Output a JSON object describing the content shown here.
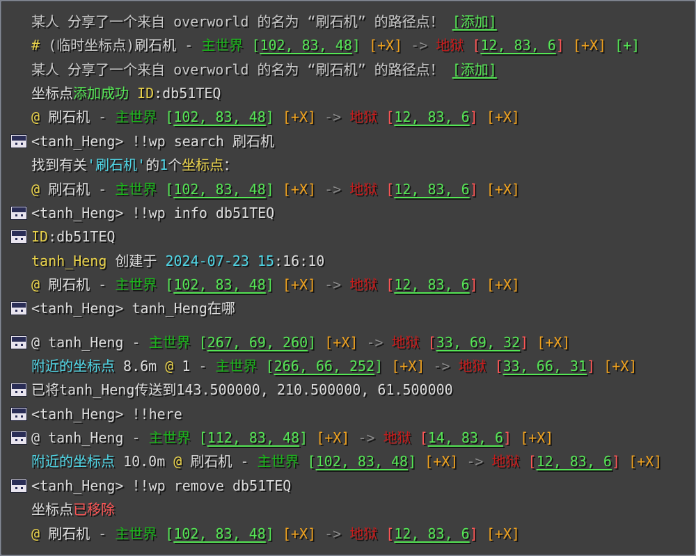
{
  "colors": {
    "white": "#dcdcdc",
    "gray": "#c8c8c8",
    "green": "#55e655",
    "dark_green": "#1bb31b",
    "gold": "#f0a21e",
    "yellow": "#e9d24a",
    "red": "#c81a1a",
    "light_red": "#ff5656",
    "aqua": "#4fd6e6",
    "arrow": "#8a8a8a"
  },
  "chat": [
    {
      "avatar": false,
      "segments": [
        {
          "t": "某人 分享了一个来自 overworld 的名为 “刷石机” 的路径点！ ",
          "c": "gray"
        },
        {
          "t": "[添加]",
          "c": "green",
          "u": true,
          "click": true
        }
      ]
    },
    {
      "avatar": false,
      "segments": [
        {
          "t": "# ",
          "c": "yellow"
        },
        {
          "t": "(临时坐标点)",
          "c": "gray"
        },
        {
          "t": "刷石机",
          "c": "white"
        },
        {
          "t": " - ",
          "c": "gray"
        },
        {
          "t": "主世界",
          "c": "dark_green"
        },
        {
          "t": " [",
          "c": "green"
        },
        {
          "t": "102, 83, 48",
          "c": "green",
          "u": true,
          "click": true
        },
        {
          "t": "] ",
          "c": "green"
        },
        {
          "t": "[+X]",
          "c": "gold",
          "click": true
        },
        {
          "t": " -> ",
          "c": "arrow"
        },
        {
          "t": "地狱",
          "c": "red"
        },
        {
          "t": " [",
          "c": "lred"
        },
        {
          "t": "12, 83, 6",
          "c": "green",
          "u": true,
          "click": true
        },
        {
          "t": "] ",
          "c": "lred"
        },
        {
          "t": "[+X]",
          "c": "gold",
          "click": true
        },
        {
          "t": " [+]",
          "c": "green",
          "click": true
        }
      ]
    },
    {
      "avatar": false,
      "segments": [
        {
          "t": "某人 分享了一个来自 overworld 的名为 “刷石机” 的路径点！ ",
          "c": "gray"
        },
        {
          "t": "[添加]",
          "c": "green",
          "u": true,
          "click": true
        }
      ]
    },
    {
      "avatar": false,
      "segments": [
        {
          "t": "坐标点",
          "c": "white"
        },
        {
          "t": "添加成功",
          "c": "green"
        },
        {
          "t": " ID",
          "c": "yellow"
        },
        {
          "t": ":db51TEQ",
          "c": "white"
        }
      ]
    },
    {
      "avatar": false,
      "segments": [
        {
          "t": "@ ",
          "c": "yellow"
        },
        {
          "t": "刷石机",
          "c": "white"
        },
        {
          "t": " - ",
          "c": "gray"
        },
        {
          "t": "主世界",
          "c": "dark_green"
        },
        {
          "t": " [",
          "c": "green"
        },
        {
          "t": "102, 83, 48",
          "c": "green",
          "u": true,
          "click": true
        },
        {
          "t": "] ",
          "c": "green"
        },
        {
          "t": "[+X]",
          "c": "gold",
          "click": true
        },
        {
          "t": " -> ",
          "c": "arrow"
        },
        {
          "t": "地狱",
          "c": "red"
        },
        {
          "t": " [",
          "c": "lred"
        },
        {
          "t": "12, 83, 6",
          "c": "green",
          "u": true,
          "click": true
        },
        {
          "t": "] ",
          "c": "lred"
        },
        {
          "t": "[+X]",
          "c": "gold",
          "click": true
        }
      ]
    },
    {
      "avatar": true,
      "segments": [
        {
          "t": "<tanh_Heng> !!wp search 刷石机",
          "c": "white"
        }
      ]
    },
    {
      "avatar": false,
      "segments": [
        {
          "t": "找到有关",
          "c": "white"
        },
        {
          "t": "'刷石机'",
          "c": "aqua"
        },
        {
          "t": "的",
          "c": "white"
        },
        {
          "t": "1",
          "c": "aqua"
        },
        {
          "t": "个",
          "c": "white"
        },
        {
          "t": "坐标点",
          "c": "yellow"
        },
        {
          "t": "：",
          "c": "white"
        }
      ]
    },
    {
      "avatar": false,
      "segments": [
        {
          "t": "@ ",
          "c": "yellow"
        },
        {
          "t": "刷石机",
          "c": "white"
        },
        {
          "t": " - ",
          "c": "gray"
        },
        {
          "t": "主世界",
          "c": "dark_green"
        },
        {
          "t": " [",
          "c": "green"
        },
        {
          "t": "102, 83, 48",
          "c": "green",
          "u": true,
          "click": true
        },
        {
          "t": "] ",
          "c": "green"
        },
        {
          "t": "[+X]",
          "c": "gold",
          "click": true
        },
        {
          "t": " -> ",
          "c": "arrow"
        },
        {
          "t": "地狱",
          "c": "red"
        },
        {
          "t": " [",
          "c": "lred"
        },
        {
          "t": "12, 83, 6",
          "c": "green",
          "u": true,
          "click": true
        },
        {
          "t": "] ",
          "c": "lred"
        },
        {
          "t": "[+X]",
          "c": "gold",
          "click": true
        }
      ]
    },
    {
      "avatar": true,
      "segments": [
        {
          "t": "<tanh_Heng> !!wp info db51TEQ",
          "c": "white"
        }
      ]
    },
    {
      "avatar": true,
      "segments": [
        {
          "t": "ID",
          "c": "yellow"
        },
        {
          "t": ":db51TEQ",
          "c": "white"
        }
      ]
    },
    {
      "avatar": false,
      "segments": [
        {
          "t": "tanh_Heng",
          "c": "yellow"
        },
        {
          "t": " 创建于 ",
          "c": "white"
        },
        {
          "t": "2024-07-23 15",
          "c": "aqua"
        },
        {
          "t": ":16:10",
          "c": "white"
        }
      ]
    },
    {
      "avatar": false,
      "segments": [
        {
          "t": "@ ",
          "c": "yellow"
        },
        {
          "t": "刷石机",
          "c": "white"
        },
        {
          "t": " - ",
          "c": "gray"
        },
        {
          "t": "主世界",
          "c": "dark_green"
        },
        {
          "t": " [",
          "c": "green"
        },
        {
          "t": "102, 83, 48",
          "c": "green",
          "u": true,
          "click": true
        },
        {
          "t": "] ",
          "c": "green"
        },
        {
          "t": "[+X]",
          "c": "gold",
          "click": true
        },
        {
          "t": " -> ",
          "c": "arrow"
        },
        {
          "t": "地狱",
          "c": "red"
        },
        {
          "t": " [",
          "c": "lred"
        },
        {
          "t": "12, 83, 6",
          "c": "green",
          "u": true,
          "click": true
        },
        {
          "t": "] ",
          "c": "lred"
        },
        {
          "t": "[+X]",
          "c": "gold",
          "click": true
        }
      ]
    },
    {
      "avatar": true,
      "segments": [
        {
          "t": "<tanh_Heng> tanh_Heng在哪",
          "c": "white"
        }
      ]
    },
    {
      "avatar": true,
      "segments": [
        {
          "t": "@ tanh_Heng",
          "c": "white"
        },
        {
          "t": " - ",
          "c": "gray"
        },
        {
          "t": "主世界",
          "c": "dark_green"
        },
        {
          "t": " [",
          "c": "green"
        },
        {
          "t": "267, 69, 260",
          "c": "green",
          "u": true,
          "click": true
        },
        {
          "t": "] ",
          "c": "green"
        },
        {
          "t": "[+X]",
          "c": "gold",
          "click": true
        },
        {
          "t": " -> ",
          "c": "arrow"
        },
        {
          "t": "地狱",
          "c": "red"
        },
        {
          "t": " [",
          "c": "lred"
        },
        {
          "t": "33, 69, 32",
          "c": "green",
          "u": true,
          "click": true
        },
        {
          "t": "] ",
          "c": "lred"
        },
        {
          "t": "[+X]",
          "c": "gold",
          "click": true
        }
      ]
    },
    {
      "avatar": false,
      "segments": [
        {
          "t": "附近的坐标点",
          "c": "aqua"
        },
        {
          "t": " 8.6m ",
          "c": "white"
        },
        {
          "t": "@ ",
          "c": "yellow"
        },
        {
          "t": "1",
          "c": "white"
        },
        {
          "t": " - ",
          "c": "gray"
        },
        {
          "t": "主世界",
          "c": "dark_green"
        },
        {
          "t": " [",
          "c": "green"
        },
        {
          "t": "266, 66, 252",
          "c": "green",
          "u": true,
          "click": true
        },
        {
          "t": "] ",
          "c": "green"
        },
        {
          "t": "[+X]",
          "c": "gold",
          "click": true
        },
        {
          "t": " -> ",
          "c": "arrow"
        },
        {
          "t": "地狱",
          "c": "red"
        },
        {
          "t": " [",
          "c": "lred"
        },
        {
          "t": "33, 66, 31",
          "c": "green",
          "u": true,
          "click": true
        },
        {
          "t": "] ",
          "c": "lred"
        },
        {
          "t": "[+X]",
          "c": "gold",
          "click": true
        }
      ]
    },
    {
      "avatar": true,
      "segments": [
        {
          "t": "已将tanh_Heng传送到143.500000, 210.500000, 61.500000",
          "c": "white"
        }
      ]
    },
    {
      "avatar": true,
      "segments": [
        {
          "t": "<tanh_Heng> !!here",
          "c": "white"
        }
      ]
    },
    {
      "avatar": true,
      "segments": [
        {
          "t": "@ tanh_Heng",
          "c": "white"
        },
        {
          "t": " - ",
          "c": "gray"
        },
        {
          "t": "主世界",
          "c": "dark_green"
        },
        {
          "t": " [",
          "c": "green"
        },
        {
          "t": "112, 83, 48",
          "c": "green",
          "u": true,
          "click": true
        },
        {
          "t": "] ",
          "c": "green"
        },
        {
          "t": "[+X]",
          "c": "gold",
          "click": true
        },
        {
          "t": " -> ",
          "c": "arrow"
        },
        {
          "t": "地狱",
          "c": "red"
        },
        {
          "t": " [",
          "c": "lred"
        },
        {
          "t": "14, 83, 6",
          "c": "green",
          "u": true,
          "click": true
        },
        {
          "t": "] ",
          "c": "lred"
        },
        {
          "t": "[+X]",
          "c": "gold",
          "click": true
        }
      ]
    },
    {
      "avatar": false,
      "segments": [
        {
          "t": "附近的坐标点",
          "c": "aqua"
        },
        {
          "t": " 10.0m ",
          "c": "white"
        },
        {
          "t": "@ ",
          "c": "yellow"
        },
        {
          "t": "刷石机",
          "c": "white"
        },
        {
          "t": " - ",
          "c": "gray"
        },
        {
          "t": "主世界",
          "c": "dark_green"
        },
        {
          "t": " [",
          "c": "green"
        },
        {
          "t": "102, 83, 48",
          "c": "green",
          "u": true,
          "click": true
        },
        {
          "t": "] ",
          "c": "green"
        },
        {
          "t": "[+X]",
          "c": "gold",
          "click": true
        },
        {
          "t": " -> ",
          "c": "arrow"
        },
        {
          "t": "地狱",
          "c": "red"
        },
        {
          "t": " [",
          "c": "lred"
        },
        {
          "t": "12, 83, 6",
          "c": "green",
          "u": true,
          "click": true
        },
        {
          "t": "] ",
          "c": "lred"
        },
        {
          "t": "[+X]",
          "c": "gold",
          "click": true
        }
      ]
    },
    {
      "avatar": true,
      "segments": [
        {
          "t": "<tanh_Heng> !!wp remove db51TEQ",
          "c": "white"
        }
      ]
    },
    {
      "avatar": false,
      "segments": [
        {
          "t": "坐标点",
          "c": "white"
        },
        {
          "t": "已移除",
          "c": "lred"
        }
      ]
    },
    {
      "avatar": false,
      "segments": [
        {
          "t": "@ ",
          "c": "yellow"
        },
        {
          "t": "刷石机",
          "c": "white"
        },
        {
          "t": " - ",
          "c": "gray"
        },
        {
          "t": "主世界",
          "c": "dark_green"
        },
        {
          "t": " [",
          "c": "green"
        },
        {
          "t": "102, 83, 48",
          "c": "green",
          "u": true,
          "click": true
        },
        {
          "t": "] ",
          "c": "green"
        },
        {
          "t": "[+X]",
          "c": "gold",
          "click": true
        },
        {
          "t": " -> ",
          "c": "arrow"
        },
        {
          "t": "地狱",
          "c": "red"
        },
        {
          "t": " [",
          "c": "lred"
        },
        {
          "t": "12, 83, 6",
          "c": "green",
          "u": true,
          "click": true
        },
        {
          "t": "] ",
          "c": "lred"
        },
        {
          "t": "[+X]",
          "c": "gold",
          "click": true
        }
      ]
    }
  ]
}
